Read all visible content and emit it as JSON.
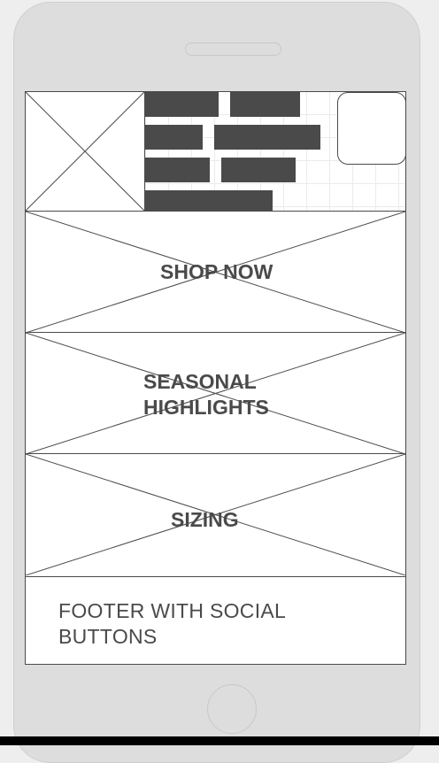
{
  "banners": {
    "shop_now": "SHOP NOW",
    "seasonal_highlights": "SEASONAL HIGHLIGHTS",
    "sizing": "SIZING"
  },
  "footer": {
    "label": "FOOTER WITH SOCIAL BUTTONS"
  },
  "colors": {
    "frame": "#dddddd",
    "wire_dark": "#4a4a4a",
    "screen": "#ffffff"
  }
}
